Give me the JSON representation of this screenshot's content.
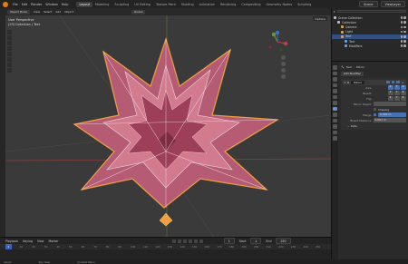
{
  "topbar": {
    "menu": [
      "File",
      "Edit",
      "Render",
      "Window",
      "Help"
    ],
    "workspaces": [
      "Layout",
      "Modeling",
      "Sculpting",
      "UV Editing",
      "Texture Paint",
      "Shading",
      "Animation",
      "Rendering",
      "Compositing",
      "Geometry Nodes",
      "Scripting"
    ],
    "active_workspace": "Layout",
    "scene": "Scene",
    "view_layer": "ViewLayer"
  },
  "viewport": {
    "mode": "Object Mode",
    "menus": [
      "View",
      "Select",
      "Add",
      "Object"
    ],
    "transform": "Global",
    "info_line1": "User Perspective",
    "info_line2": "(23) Collection | Text",
    "options": "Options"
  },
  "outliner": {
    "title": "Scene Collection",
    "rows": [
      {
        "label": "Scene Collection",
        "indent": 0,
        "color": "#bbbbbb",
        "selected": false
      },
      {
        "label": "Collection",
        "indent": 1,
        "color": "#bbbbbb",
        "selected": false
      },
      {
        "label": "Camera",
        "indent": 2,
        "color": "#d4a35a",
        "selected": false
      },
      {
        "label": "Light",
        "indent": 2,
        "color": "#d4a35a",
        "selected": false
      },
      {
        "label": "Text",
        "indent": 2,
        "color": "#d4a35a",
        "selected": true
      },
      {
        "label": "Text",
        "indent": 3,
        "color": "#6fa0d8",
        "selected": false
      },
      {
        "label": "Modifiers",
        "indent": 3,
        "color": "#6fa0d8",
        "selected": false
      }
    ]
  },
  "properties": {
    "object_name": "Text",
    "modifier_tab": "Mirror",
    "add_modifier": "Add Modifier",
    "modifier_name": "Mirror",
    "axis_label": "Axis",
    "bisect_label": "Bisect",
    "flip_label": "Flip",
    "axes": [
      "X",
      "Y",
      "Z"
    ],
    "mirror_object_label": "Mirror Object",
    "clipping_label": "Clipping",
    "merge_label": "Merge",
    "merge_value": "0.001 m",
    "bisect_distance_label": "Bisect Distance",
    "bisect_distance_value": "0.001 m",
    "data_label": "Data"
  },
  "timeline": {
    "menus": [
      "Playback",
      "Keying",
      "View",
      "Marker"
    ],
    "current_frame": "1",
    "start_label": "Start",
    "start": "1",
    "end_label": "End",
    "end": "250",
    "ticks": [
      "0",
      "10",
      "20",
      "30",
      "40",
      "50",
      "60",
      "70",
      "80",
      "90",
      "100",
      "110",
      "120",
      "130",
      "140",
      "150",
      "160",
      "170",
      "180",
      "190",
      "200",
      "210",
      "220",
      "230",
      "240",
      "250"
    ]
  },
  "statusbar": {
    "items": [
      "Select",
      "Pan View",
      "Context Menu"
    ]
  },
  "colors": {
    "accent": "#4772b3",
    "blender_orange": "#e87d0d",
    "selection": "#334f80"
  }
}
